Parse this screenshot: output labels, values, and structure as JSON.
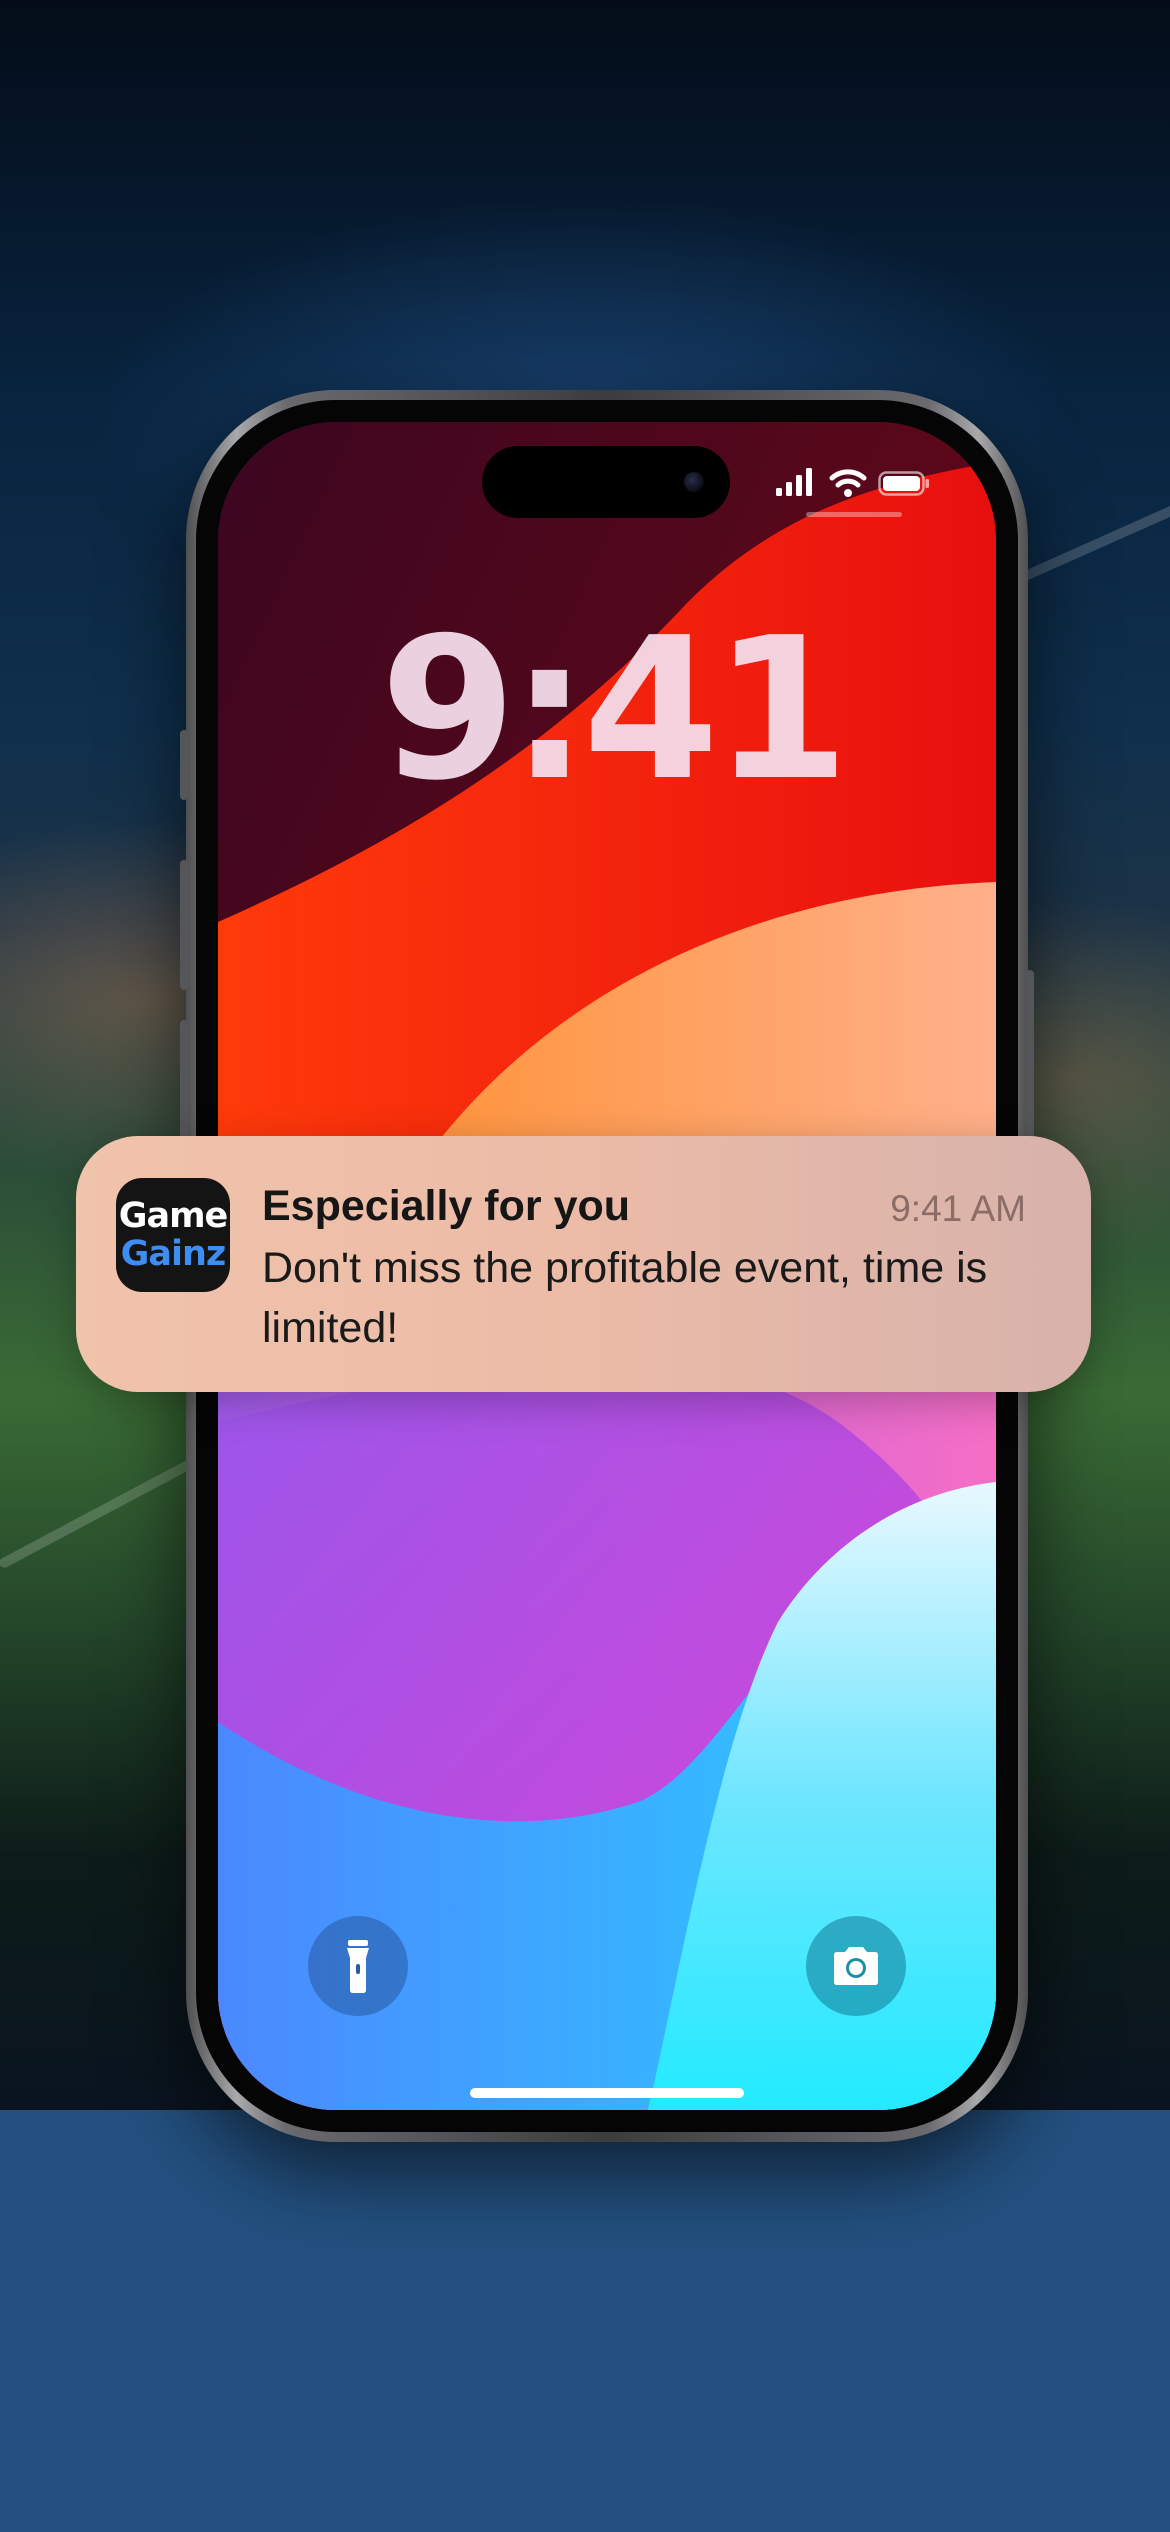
{
  "lock_screen": {
    "time": "9:41"
  },
  "notification": {
    "app_icon_text_line1": "Game",
    "app_icon_text_line2": "Gainz",
    "title": "Especially for you",
    "time": "9:41 AM",
    "body": "Don't miss the profitable event, time is limited!"
  },
  "status_bar": {
    "signal_icon": "cellular-signal-icon",
    "wifi_icon": "wifi-icon",
    "battery_icon": "battery-icon"
  },
  "controls": {
    "flashlight_icon": "flashlight-icon",
    "camera_icon": "camera-icon"
  },
  "colors": {
    "brand_blue": "#3e8df0",
    "notification_bg": "#ecbba7",
    "page_bottom": "#23507f"
  }
}
